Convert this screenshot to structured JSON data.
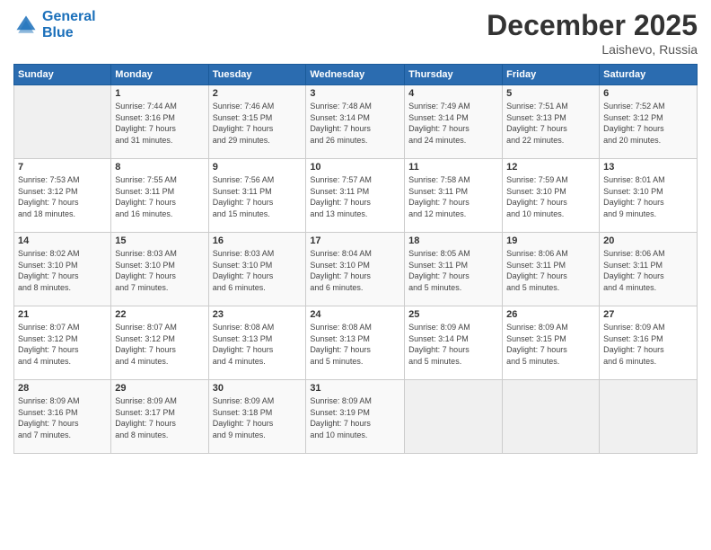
{
  "logo": {
    "line1": "General",
    "line2": "Blue"
  },
  "header": {
    "month": "December 2025",
    "location": "Laishevo, Russia"
  },
  "days_of_week": [
    "Sunday",
    "Monday",
    "Tuesday",
    "Wednesday",
    "Thursday",
    "Friday",
    "Saturday"
  ],
  "weeks": [
    [
      {
        "day": "",
        "info": ""
      },
      {
        "day": "1",
        "info": "Sunrise: 7:44 AM\nSunset: 3:16 PM\nDaylight: 7 hours\nand 31 minutes."
      },
      {
        "day": "2",
        "info": "Sunrise: 7:46 AM\nSunset: 3:15 PM\nDaylight: 7 hours\nand 29 minutes."
      },
      {
        "day": "3",
        "info": "Sunrise: 7:48 AM\nSunset: 3:14 PM\nDaylight: 7 hours\nand 26 minutes."
      },
      {
        "day": "4",
        "info": "Sunrise: 7:49 AM\nSunset: 3:14 PM\nDaylight: 7 hours\nand 24 minutes."
      },
      {
        "day": "5",
        "info": "Sunrise: 7:51 AM\nSunset: 3:13 PM\nDaylight: 7 hours\nand 22 minutes."
      },
      {
        "day": "6",
        "info": "Sunrise: 7:52 AM\nSunset: 3:12 PM\nDaylight: 7 hours\nand 20 minutes."
      }
    ],
    [
      {
        "day": "7",
        "info": "Sunrise: 7:53 AM\nSunset: 3:12 PM\nDaylight: 7 hours\nand 18 minutes."
      },
      {
        "day": "8",
        "info": "Sunrise: 7:55 AM\nSunset: 3:11 PM\nDaylight: 7 hours\nand 16 minutes."
      },
      {
        "day": "9",
        "info": "Sunrise: 7:56 AM\nSunset: 3:11 PM\nDaylight: 7 hours\nand 15 minutes."
      },
      {
        "day": "10",
        "info": "Sunrise: 7:57 AM\nSunset: 3:11 PM\nDaylight: 7 hours\nand 13 minutes."
      },
      {
        "day": "11",
        "info": "Sunrise: 7:58 AM\nSunset: 3:11 PM\nDaylight: 7 hours\nand 12 minutes."
      },
      {
        "day": "12",
        "info": "Sunrise: 7:59 AM\nSunset: 3:10 PM\nDaylight: 7 hours\nand 10 minutes."
      },
      {
        "day": "13",
        "info": "Sunrise: 8:01 AM\nSunset: 3:10 PM\nDaylight: 7 hours\nand 9 minutes."
      }
    ],
    [
      {
        "day": "14",
        "info": "Sunrise: 8:02 AM\nSunset: 3:10 PM\nDaylight: 7 hours\nand 8 minutes."
      },
      {
        "day": "15",
        "info": "Sunrise: 8:03 AM\nSunset: 3:10 PM\nDaylight: 7 hours\nand 7 minutes."
      },
      {
        "day": "16",
        "info": "Sunrise: 8:03 AM\nSunset: 3:10 PM\nDaylight: 7 hours\nand 6 minutes."
      },
      {
        "day": "17",
        "info": "Sunrise: 8:04 AM\nSunset: 3:10 PM\nDaylight: 7 hours\nand 6 minutes."
      },
      {
        "day": "18",
        "info": "Sunrise: 8:05 AM\nSunset: 3:11 PM\nDaylight: 7 hours\nand 5 minutes."
      },
      {
        "day": "19",
        "info": "Sunrise: 8:06 AM\nSunset: 3:11 PM\nDaylight: 7 hours\nand 5 minutes."
      },
      {
        "day": "20",
        "info": "Sunrise: 8:06 AM\nSunset: 3:11 PM\nDaylight: 7 hours\nand 4 minutes."
      }
    ],
    [
      {
        "day": "21",
        "info": "Sunrise: 8:07 AM\nSunset: 3:12 PM\nDaylight: 7 hours\nand 4 minutes."
      },
      {
        "day": "22",
        "info": "Sunrise: 8:07 AM\nSunset: 3:12 PM\nDaylight: 7 hours\nand 4 minutes."
      },
      {
        "day": "23",
        "info": "Sunrise: 8:08 AM\nSunset: 3:13 PM\nDaylight: 7 hours\nand 4 minutes."
      },
      {
        "day": "24",
        "info": "Sunrise: 8:08 AM\nSunset: 3:13 PM\nDaylight: 7 hours\nand 5 minutes."
      },
      {
        "day": "25",
        "info": "Sunrise: 8:09 AM\nSunset: 3:14 PM\nDaylight: 7 hours\nand 5 minutes."
      },
      {
        "day": "26",
        "info": "Sunrise: 8:09 AM\nSunset: 3:15 PM\nDaylight: 7 hours\nand 5 minutes."
      },
      {
        "day": "27",
        "info": "Sunrise: 8:09 AM\nSunset: 3:16 PM\nDaylight: 7 hours\nand 6 minutes."
      }
    ],
    [
      {
        "day": "28",
        "info": "Sunrise: 8:09 AM\nSunset: 3:16 PM\nDaylight: 7 hours\nand 7 minutes."
      },
      {
        "day": "29",
        "info": "Sunrise: 8:09 AM\nSunset: 3:17 PM\nDaylight: 7 hours\nand 8 minutes."
      },
      {
        "day": "30",
        "info": "Sunrise: 8:09 AM\nSunset: 3:18 PM\nDaylight: 7 hours\nand 9 minutes."
      },
      {
        "day": "31",
        "info": "Sunrise: 8:09 AM\nSunset: 3:19 PM\nDaylight: 7 hours\nand 10 minutes."
      },
      {
        "day": "",
        "info": ""
      },
      {
        "day": "",
        "info": ""
      },
      {
        "day": "",
        "info": ""
      }
    ]
  ]
}
